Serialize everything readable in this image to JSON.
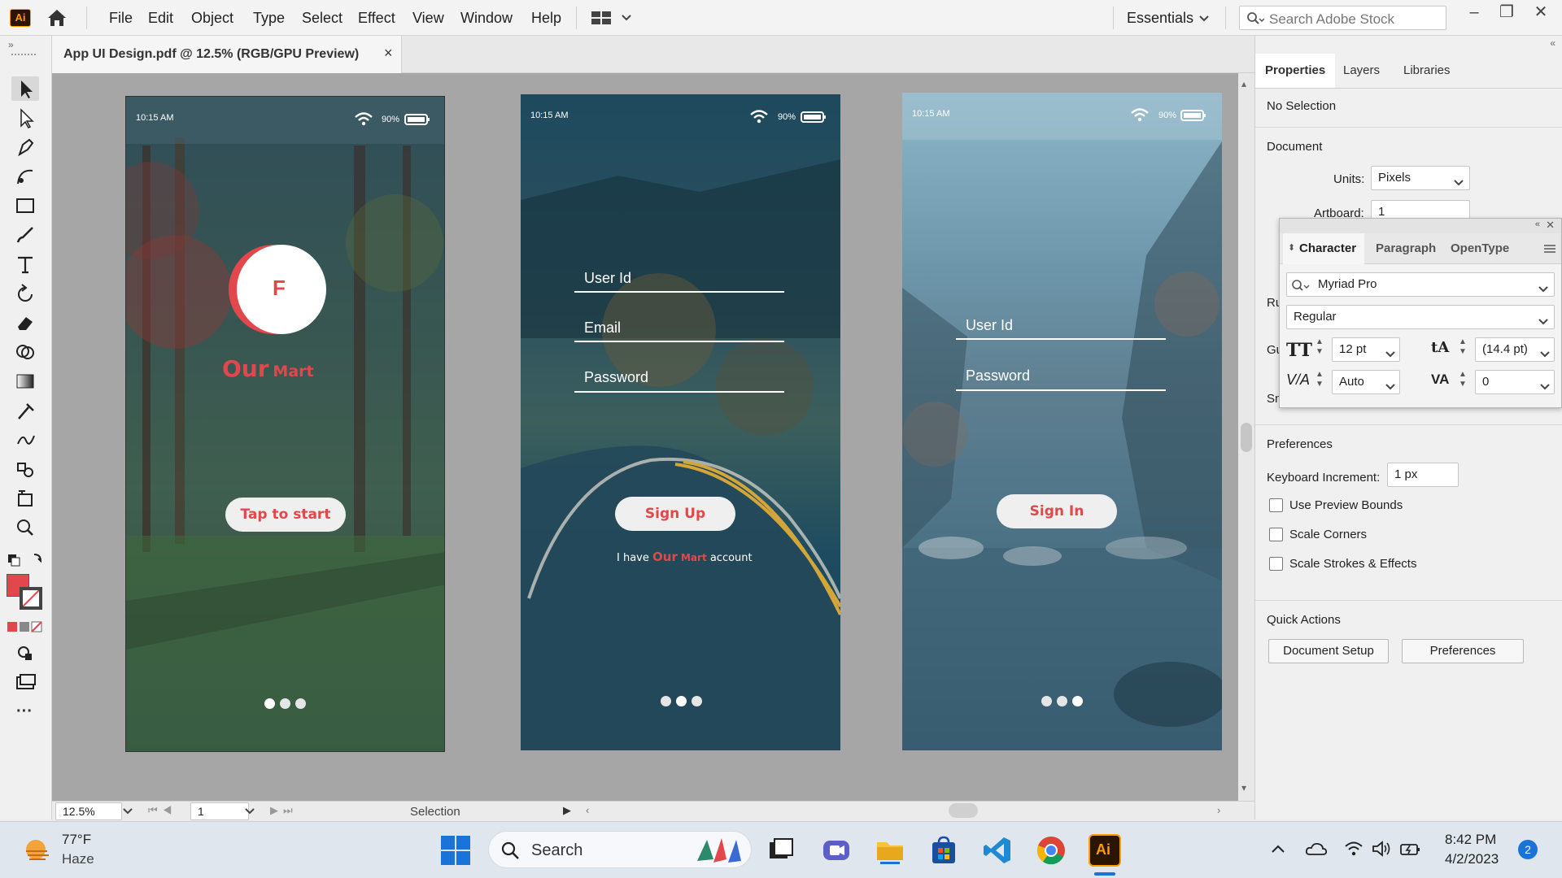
{
  "app": {
    "logo": "Ai"
  },
  "menu": [
    "File",
    "Edit",
    "Object",
    "Type",
    "Select",
    "Effect",
    "View",
    "Window",
    "Help"
  ],
  "workspace": "Essentials",
  "search_stock": {
    "placeholder": "Search Adobe Stock"
  },
  "document_tab": {
    "title": "App UI Design.pdf @ 12.5% (RGB/GPU Preview)",
    "close": "×"
  },
  "status": {
    "zoom": "12.5%",
    "artboard": "1",
    "tool": "Selection"
  },
  "panel": {
    "tabs": [
      "Properties",
      "Layers",
      "Libraries"
    ],
    "no_selection": "No Selection",
    "document": "Document",
    "units_label": "Units:",
    "units_value": "Pixels",
    "artboard_label": "Artboard:",
    "artboard_value": "1",
    "ru": "Ru",
    "gu": "Gu",
    "sn": "Sn",
    "preferences": "Preferences",
    "keyboard_increment_label": "Keyboard Increment:",
    "keyboard_increment_value": "1 px",
    "checkboxes": [
      "Use Preview Bounds",
      "Scale Corners",
      "Scale Strokes & Effects"
    ],
    "quick_actions": "Quick Actions",
    "btn_document_setup": "Document Setup",
    "btn_preferences": "Preferences"
  },
  "character": {
    "tabs": [
      "Character",
      "Paragraph",
      "OpenType"
    ],
    "font": "Myriad Pro",
    "style": "Regular",
    "size": "12 pt",
    "leading": "(14.4 pt)",
    "kerning": "Auto",
    "tracking": "0"
  },
  "phones": {
    "time": "10:15 AM",
    "battery": "90%",
    "p1": {
      "logo_letter": "F",
      "brand_our": "Our",
      "brand_mart": "Mart",
      "button": "Tap to start"
    },
    "p2": {
      "field1": "User Id",
      "field2": "Email",
      "field3": "Password",
      "button": "Sign Up",
      "note_pre": "I have",
      "note_our": "Our",
      "note_mart": "Mart",
      "note_post": "account"
    },
    "p3": {
      "field1": "User Id",
      "field2": "Password",
      "button": "Sign In"
    }
  },
  "taskbar": {
    "weather_temp": "77°F",
    "weather_desc": "Haze",
    "search": "Search",
    "time": "8:42 PM",
    "date": "4/2/2023",
    "notifications": "2"
  },
  "colors": {
    "accent_red": "#e2474b",
    "ai_orange": "#ff9a00",
    "ai_bg": "#2b1400"
  }
}
